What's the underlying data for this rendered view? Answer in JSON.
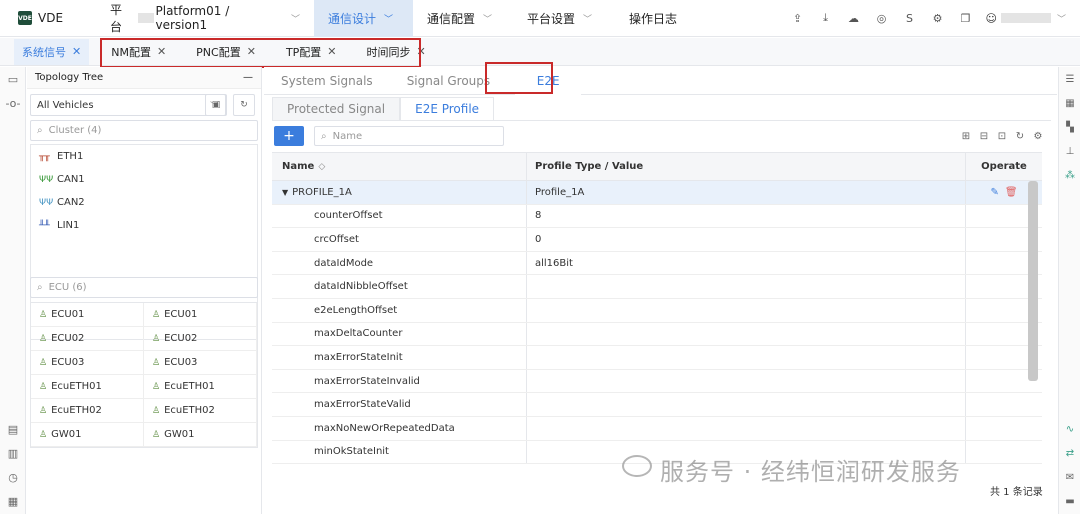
{
  "app": {
    "logo_text": "VDE",
    "logo_mark": "VDE"
  },
  "nav": {
    "platform_label": "平台",
    "platform_value": "Platform01 / version1",
    "items": [
      {
        "label": "通信设计",
        "active": true
      },
      {
        "label": "通信配置"
      },
      {
        "label": "平台设置"
      },
      {
        "label": "操作日志"
      }
    ],
    "right_icons": [
      "upload-icon",
      "download-icon",
      "cloud-icon",
      "target-icon",
      "s-icon",
      "gear-icon",
      "copy-icon",
      "user-icon"
    ],
    "s_label": "S"
  },
  "tabs": [
    {
      "label": "系统信号",
      "active": true
    },
    {
      "label": "NM配置"
    },
    {
      "label": "PNC配置"
    },
    {
      "label": "TP配置"
    },
    {
      "label": "时间同步"
    }
  ],
  "topology": {
    "title": "Topology Tree",
    "vehicle_select": "All Vehicles",
    "cluster_placeholder": "Cluster (4)",
    "buses": [
      {
        "name": "ETH1",
        "color": "#b5452e"
      },
      {
        "name": "CAN1",
        "color": "#3c9a3c"
      },
      {
        "name": "CAN2",
        "color": "#4a97c4"
      },
      {
        "name": "LIN1",
        "color": "#3a5fb5"
      }
    ],
    "ecu_placeholder": "ECU (6)",
    "ecus": [
      "ECU01",
      "ECU01",
      "ECU02",
      "ECU02",
      "ECU03",
      "ECU03",
      "EcuETH01",
      "EcuETH01",
      "EcuETH02",
      "EcuETH02",
      "GW01",
      "GW01"
    ]
  },
  "main": {
    "sub_tabs": [
      {
        "label": "System Signals"
      },
      {
        "label": "Signal Groups"
      },
      {
        "label": "E2E",
        "active": true
      }
    ],
    "inner_tabs": [
      {
        "label": "Protected Signal"
      },
      {
        "label": "E2E Profile",
        "active": true
      }
    ],
    "add_label": "+",
    "name_placeholder": "Name",
    "table": {
      "headers": {
        "name": "Name",
        "type": "Profile Type / Value",
        "operate": "Operate"
      },
      "profile": {
        "name": "PROFILE_1A",
        "value": "Profile_1A"
      },
      "rows": [
        {
          "name": "counterOffset",
          "value": "8"
        },
        {
          "name": "crcOffset",
          "value": "0"
        },
        {
          "name": "dataIdMode",
          "value": "all16Bit"
        },
        {
          "name": "dataIdNibbleOffset",
          "value": ""
        },
        {
          "name": "e2eLengthOffset",
          "value": ""
        },
        {
          "name": "maxDeltaCounter",
          "value": ""
        },
        {
          "name": "maxErrorStateInit",
          "value": ""
        },
        {
          "name": "maxErrorStateInvalid",
          "value": ""
        },
        {
          "name": "maxErrorStateValid",
          "value": ""
        },
        {
          "name": "maxNoNewOrRepeatedData",
          "value": ""
        },
        {
          "name": "minOkStateInit",
          "value": ""
        }
      ]
    },
    "footer": "共 1 条记录",
    "watermark": "服务号 · 经纬恒润研发服务"
  },
  "colors": {
    "accent": "#3b7ddd",
    "highlight": "#c92a2a"
  }
}
